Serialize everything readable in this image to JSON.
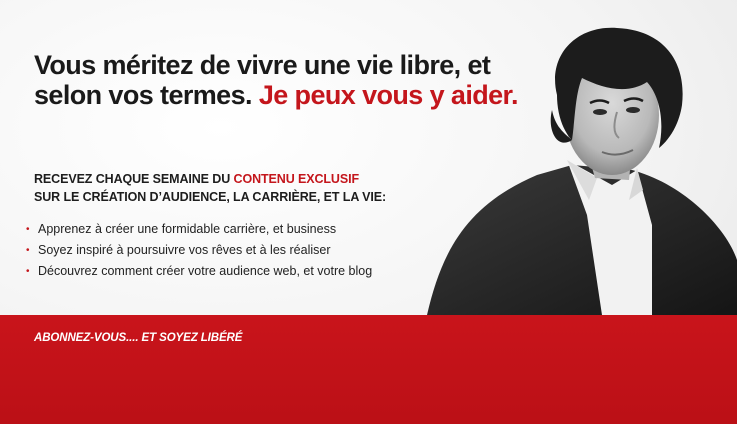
{
  "hero": {
    "headline_main": "Vous méritez de vivre une vie libre, et selon vos termes.",
    "headline_accent": "Je peux vous y aider."
  },
  "intro": {
    "line1_prefix": "RECEVEZ CHAQUE SEMAINE DU",
    "line1_accent": "CONTENU EXCLUSIF",
    "line2": "SUR LE CRÉATION D’AUDIENCE, LA CARRIÈRE, ET LA VIE:"
  },
  "benefits": [
    "Apprenez à créer une formidable carrière, et business",
    "Soyez inspiré à poursuivre vos rêves et à les réaliser",
    "Découvrez comment créer votre audience web, et votre blog"
  ],
  "bullet_symbol": "•",
  "footer": {
    "cta_label": "ABONNEZ-VOUS.... ET SOYEZ LIBÉRÉ"
  },
  "colors": {
    "accent": "#c4161c",
    "footer_band": "#c9141b",
    "text": "#1a1a1a"
  },
  "icons": {
    "portrait": "man-portrait-photo"
  }
}
